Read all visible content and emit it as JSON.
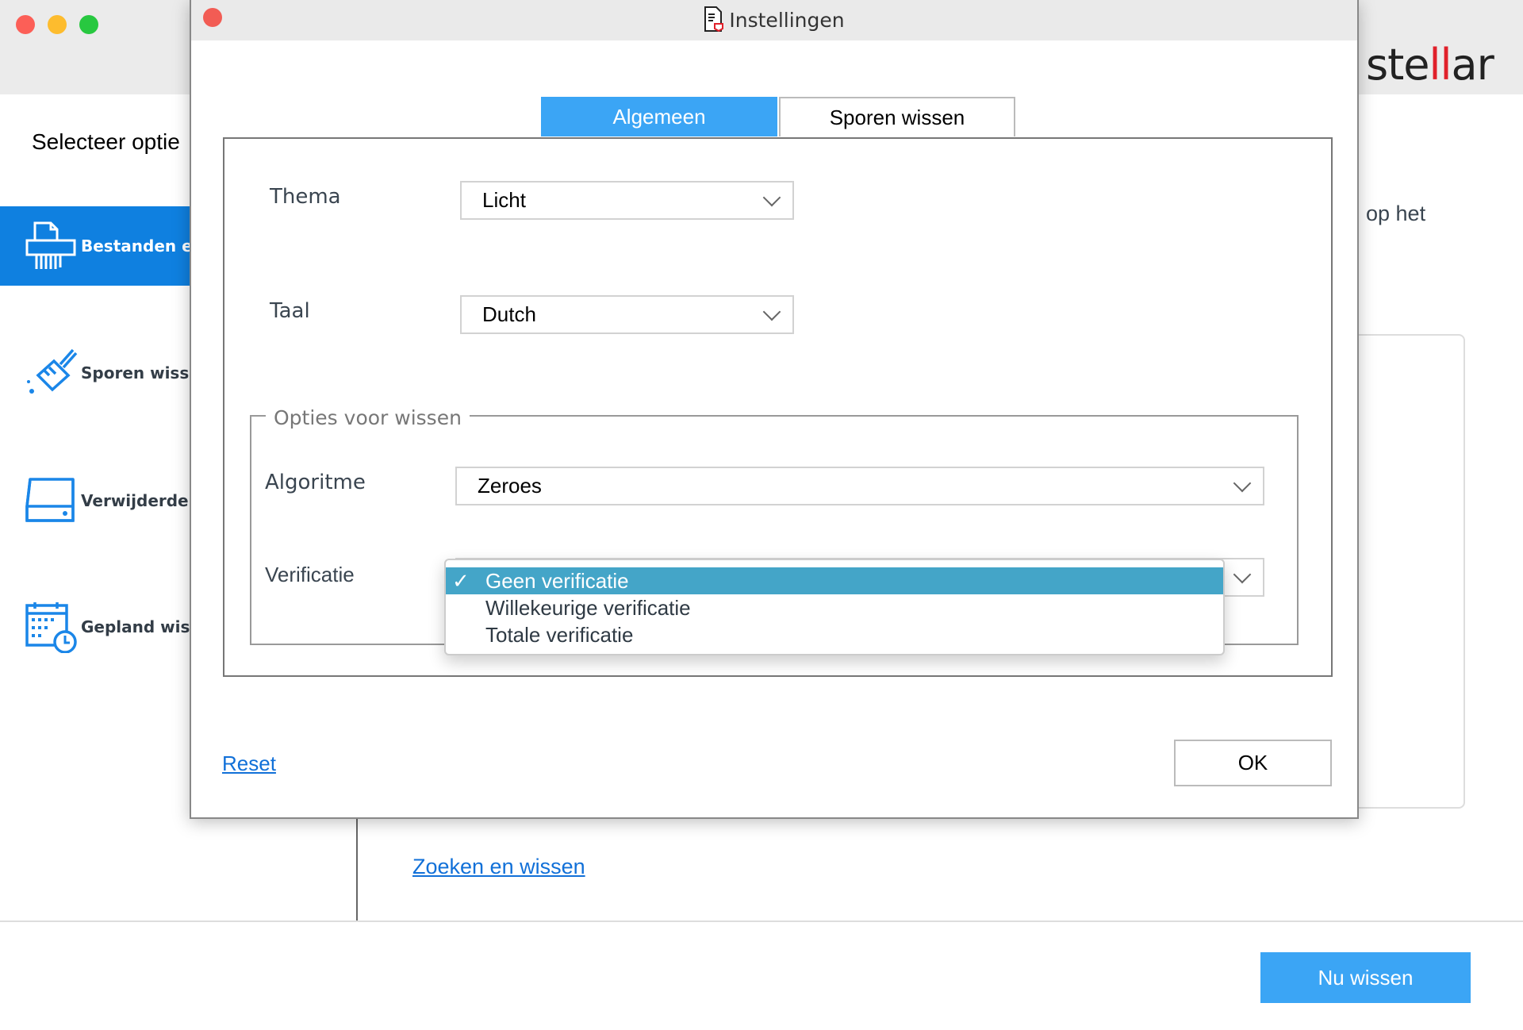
{
  "window": {
    "traffic_lights": [
      "#fc5f57",
      "#fdbc2e",
      "#28c840"
    ]
  },
  "brand": {
    "logo_text_a": "ste",
    "logo_text_b": "ar",
    "logo_full": "stellar",
    "accent": "#e0202a"
  },
  "sidebar": {
    "title": "Selecteer optie",
    "items": [
      {
        "label": "Bestanden en",
        "icon": "shredder-icon",
        "active": true
      },
      {
        "label": "Sporen wisse",
        "icon": "broom-icon"
      },
      {
        "label": "Verwijderde g",
        "icon": "drive-icon"
      },
      {
        "label": "Gepland wiss",
        "icon": "calendar-clock-icon"
      }
    ]
  },
  "main": {
    "partial_text": "op het",
    "link": "Zoeken en wissen",
    "primary_button": "Nu wissen"
  },
  "dialog": {
    "title": "Instellingen",
    "tabs": [
      {
        "label": "Algemeen",
        "active": true
      },
      {
        "label": "Sporen wissen"
      }
    ],
    "thema": {
      "label": "Thema",
      "value": "Licht"
    },
    "taal": {
      "label": "Taal",
      "value": "Dutch"
    },
    "group": {
      "legend": "Opties voor wissen",
      "algoritme": {
        "label": "Algoritme",
        "value": "Zeroes"
      },
      "verificatie": {
        "label": "Verificatie",
        "options": [
          "Geen verificatie",
          "Willekeurige verificatie",
          "Totale verificatie"
        ],
        "selected": "Geen verificatie",
        "check": "✓"
      }
    },
    "reset": "Reset",
    "ok": "OK"
  }
}
